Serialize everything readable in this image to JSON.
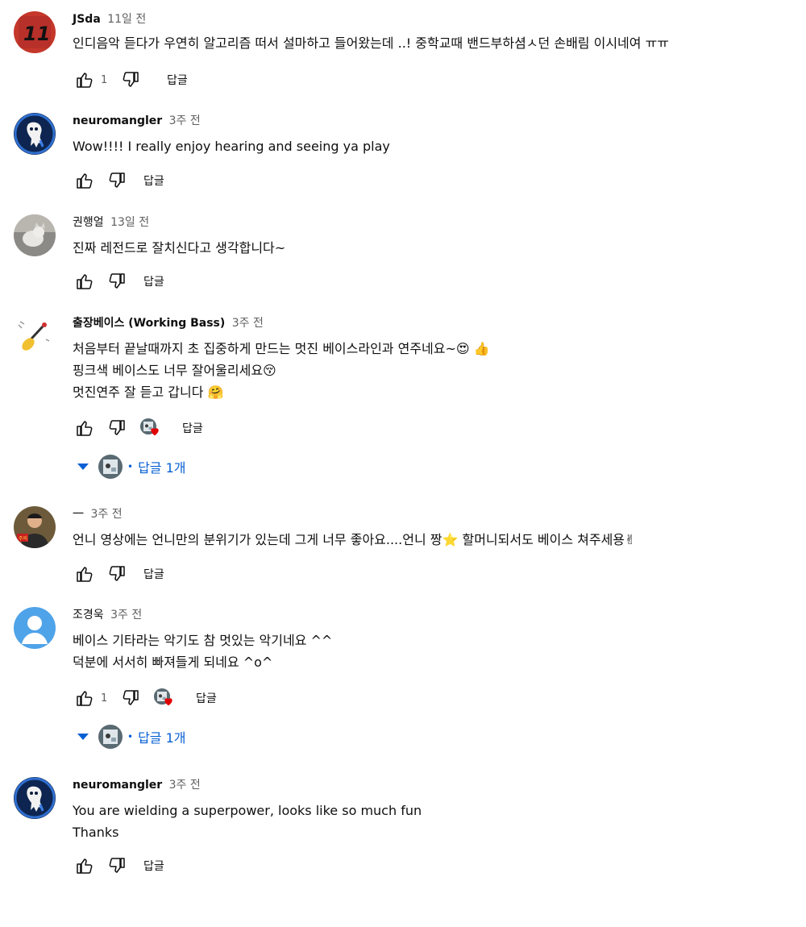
{
  "comments": [
    {
      "author": "JSda",
      "time": "11일 전",
      "lines": [
        "인디음악 듣다가 우연히 알고리즘 떠서 설마하고 들어왔는데 ..! 중학교때 밴드부하셤ㅅ던 손배림 이시네여 ㅠㅠ"
      ],
      "likes": "1",
      "reply_label": "답글"
    },
    {
      "author": "neuromangler",
      "time": "3주 전",
      "lines": [
        "Wow!!!!  I really enjoy hearing and seeing ya play"
      ],
      "likes": "",
      "reply_label": "답글"
    },
    {
      "author": "권행얼",
      "time": "13일 전",
      "lines": [
        "진짜 레전드로 잘치신다고 생각합니다~"
      ],
      "likes": "",
      "reply_label": "답글"
    },
    {
      "author": "출장베이스 (Working Bass)",
      "time": "3주 전",
      "lines": [
        "처음부터 끝날때까지 초 집중하게 만드는 멋진 베이스라인과 연주네요~😍 👍",
        "핑크색 베이스도 너무 잘어울리세요😚",
        "멋진연주 잘 듣고 갑니다 🤗"
      ],
      "likes": "",
      "reply_label": "답글",
      "replies_label": "답글 1개"
    },
    {
      "author": "一",
      "time": "3주 전",
      "lines": [
        "언니 영상에는 언니만의 분위기가 있는데 그게 너무 좋아요....언니 짱⭐ 할머니되서도 베이스 쳐주세용✌"
      ],
      "likes": "",
      "reply_label": "답글"
    },
    {
      "author": "조경욱",
      "time": "3주 전",
      "lines": [
        "베이스 기타라는 악기도 참 멋있는 악기네요 ^^",
        "덕분에 서서히 빠져들게 되네요 ^o^"
      ],
      "likes": "1",
      "reply_label": "답글",
      "replies_label": "답글 1개"
    },
    {
      "author": "neuromangler",
      "time": "3주 전",
      "lines": [
        "You are wielding a superpower, looks like so much fun",
        "Thanks"
      ],
      "likes": "",
      "reply_label": "답글"
    }
  ],
  "colors": {
    "link_blue": "#065fd4",
    "secondary_text": "#606060",
    "heart_red": "#e00000"
  },
  "icons": {
    "like": "thumb-up-icon",
    "dislike": "thumb-down-icon",
    "heart": "creator-heart-icon",
    "expand": "triangle-down-icon"
  }
}
